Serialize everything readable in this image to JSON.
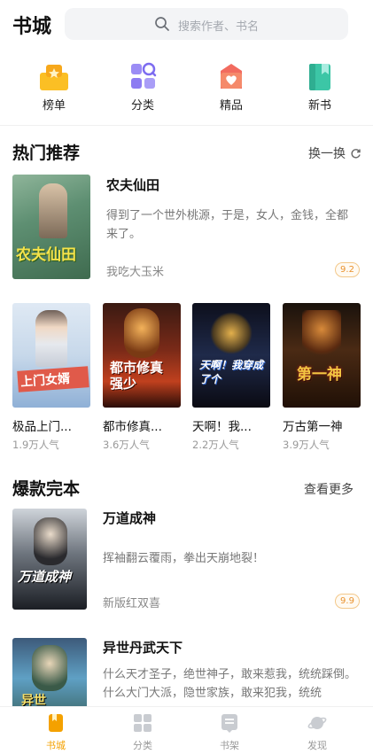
{
  "header": {
    "title": "书城",
    "search_placeholder": "搜索作者、书名"
  },
  "categories": [
    {
      "label": "榜单",
      "icon": "ranking-icon",
      "color": "#f7b825"
    },
    {
      "label": "分类",
      "icon": "category-icon",
      "color": "#8d7cf2"
    },
    {
      "label": "精品",
      "icon": "premium-icon",
      "color": "#f5685d"
    },
    {
      "label": "新书",
      "icon": "new-book-icon",
      "color": "#3cc6a6"
    }
  ],
  "hot": {
    "title": "热门推荐",
    "refresh_label": "换一换",
    "featured": {
      "title": "农夫仙田",
      "description": "得到了一个世外桃源，于是，女人，金钱，全都来了。",
      "author": "我吃大玉米",
      "score": "9.2",
      "cover_text": "农夫仙田"
    },
    "grid": [
      {
        "name": "极品上门...",
        "popularity": "1.9万人气",
        "cover_text": "上门女婿"
      },
      {
        "name": "都市修真...",
        "popularity": "3.6万人气",
        "cover_text": "都市修真强少"
      },
      {
        "name": "天啊！我...",
        "popularity": "2.2万人气",
        "cover_text": "天啊！我穿成了个"
      },
      {
        "name": "万古第一神",
        "popularity": "3.9万人气",
        "cover_text": "第一神"
      }
    ]
  },
  "complete": {
    "title": "爆款完本",
    "more_label": "查看更多",
    "books": [
      {
        "title": "万道成神",
        "description": "挥袖翻云覆雨，拳出天崩地裂！",
        "author": "新版红双喜",
        "score": "9.9",
        "cover_text": "万道成神"
      },
      {
        "title": "异世丹武天下",
        "description": "什么天才圣子，绝世神子，敢来惹我，统统踩倒。什么大门大派，隐世家族，敢来犯我，统统",
        "cover_text": "异世"
      }
    ]
  },
  "nav": [
    {
      "label": "书城",
      "icon": "bookstore-icon",
      "active": true
    },
    {
      "label": "分类",
      "icon": "category-grid-icon",
      "active": false
    },
    {
      "label": "书架",
      "icon": "bookshelf-icon",
      "active": false
    },
    {
      "label": "发现",
      "icon": "discover-icon",
      "active": false
    }
  ],
  "colors": {
    "accent": "#f4a100",
    "score_text": "#e9922f"
  }
}
